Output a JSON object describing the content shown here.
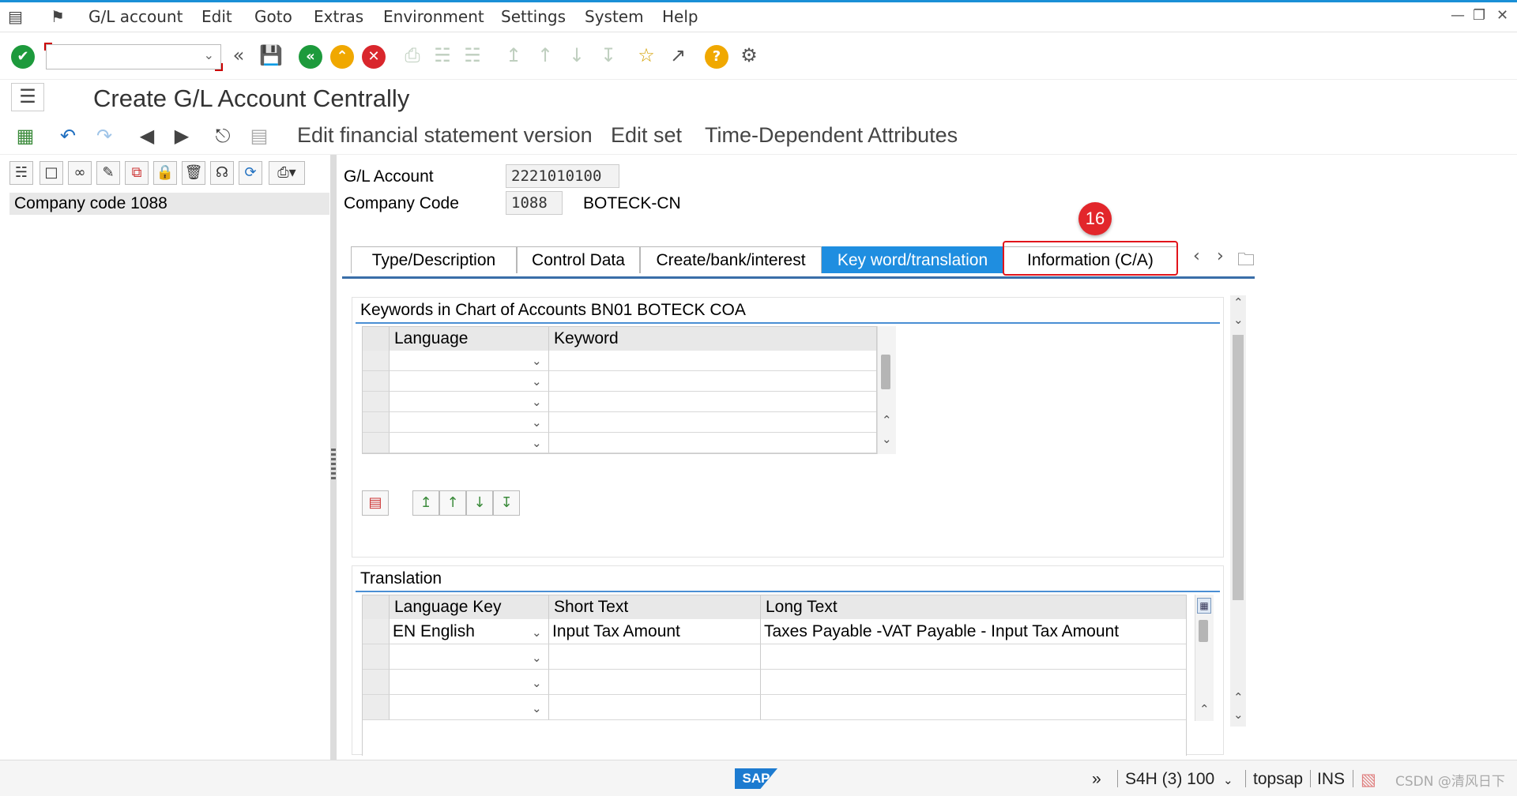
{
  "menubar": {
    "items": [
      "G/L account",
      "Edit",
      "Goto",
      "Extras",
      "Environment",
      "Settings",
      "System",
      "Help"
    ]
  },
  "toolbar": {
    "command_value": ""
  },
  "title": "Create G/L Account Centrally",
  "app_toolbar": {
    "buttons": [
      "Edit financial statement version",
      "Edit set",
      "Time-Dependent Attributes"
    ]
  },
  "tree": {
    "node": "Company code 1088"
  },
  "header": {
    "gl_account_label": "G/L Account",
    "gl_account_value": "2221010100",
    "company_code_label": "Company Code",
    "company_code_value": "1088",
    "company_name": "BOTECK-CN"
  },
  "tabs": [
    "Type/Description",
    "Control Data",
    "Create/bank/interest",
    "Key word/translation",
    "Information (C/A)"
  ],
  "active_tab": "Key word/translation",
  "annotation": {
    "step_number": "16"
  },
  "keywords": {
    "title": "Keywords in Chart of Accounts BN01 BOTECK COA",
    "columns": [
      "Language",
      "Keyword"
    ],
    "rows": [
      [
        "",
        ""
      ],
      [
        "",
        ""
      ],
      [
        "",
        ""
      ],
      [
        "",
        ""
      ],
      [
        "",
        ""
      ]
    ]
  },
  "translation": {
    "title": "Translation",
    "columns": [
      "Language Key",
      "Short Text",
      "Long Text"
    ],
    "rows": [
      [
        "EN English",
        "Input Tax Amount",
        "Taxes Payable -VAT Payable - Input Tax Amount"
      ],
      [
        "",
        "",
        ""
      ],
      [
        "",
        "",
        ""
      ],
      [
        "",
        "",
        ""
      ]
    ]
  },
  "statusbar": {
    "logo": "SAP",
    "system": "S4H (3) 100",
    "server": "topsap",
    "mode": "INS",
    "watermark": "CSDN @清风日下"
  },
  "colors": {
    "accent": "#1f8ee0",
    "highlight": "#e1141b",
    "ok_green": "#1d9a3c",
    "cancel_red": "#d9262c",
    "help_orange": "#f0a800"
  }
}
